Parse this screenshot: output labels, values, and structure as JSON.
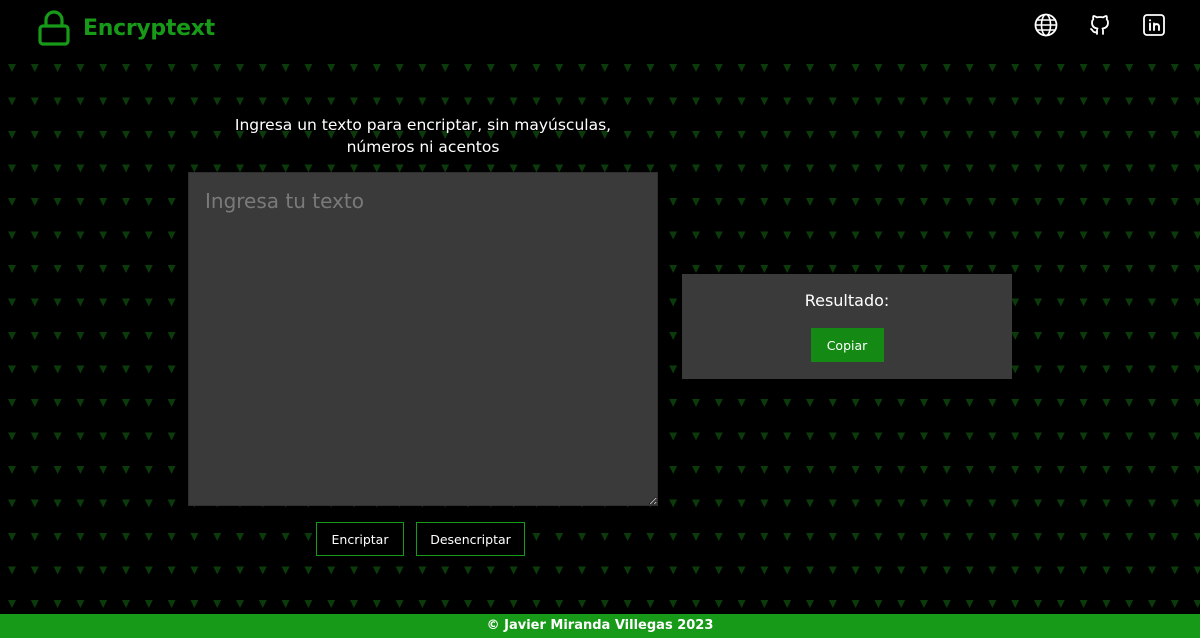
{
  "header": {
    "title": "Encryptext",
    "icons": {
      "brand": "lock-icon",
      "website": "globe-icon",
      "github": "github-icon",
      "linkedin": "linkedin-icon"
    }
  },
  "encrypt": {
    "instructions": "Ingresa un texto para encriptar, sin mayúsculas, números ni acentos",
    "input_placeholder": "Ingresa tu texto",
    "input_value": "",
    "encrypt_label": "Encriptar",
    "decrypt_label": "Desencriptar"
  },
  "result": {
    "label": "Resultado:",
    "copy_label": "Copiar"
  },
  "footer": {
    "text": "© Javier Miranda Villegas 2023"
  },
  "colors": {
    "accent": "#179a17",
    "background": "#000000",
    "panel": "#3a3a3a",
    "text": "#ffffff",
    "pattern": "#0b3a0b"
  }
}
